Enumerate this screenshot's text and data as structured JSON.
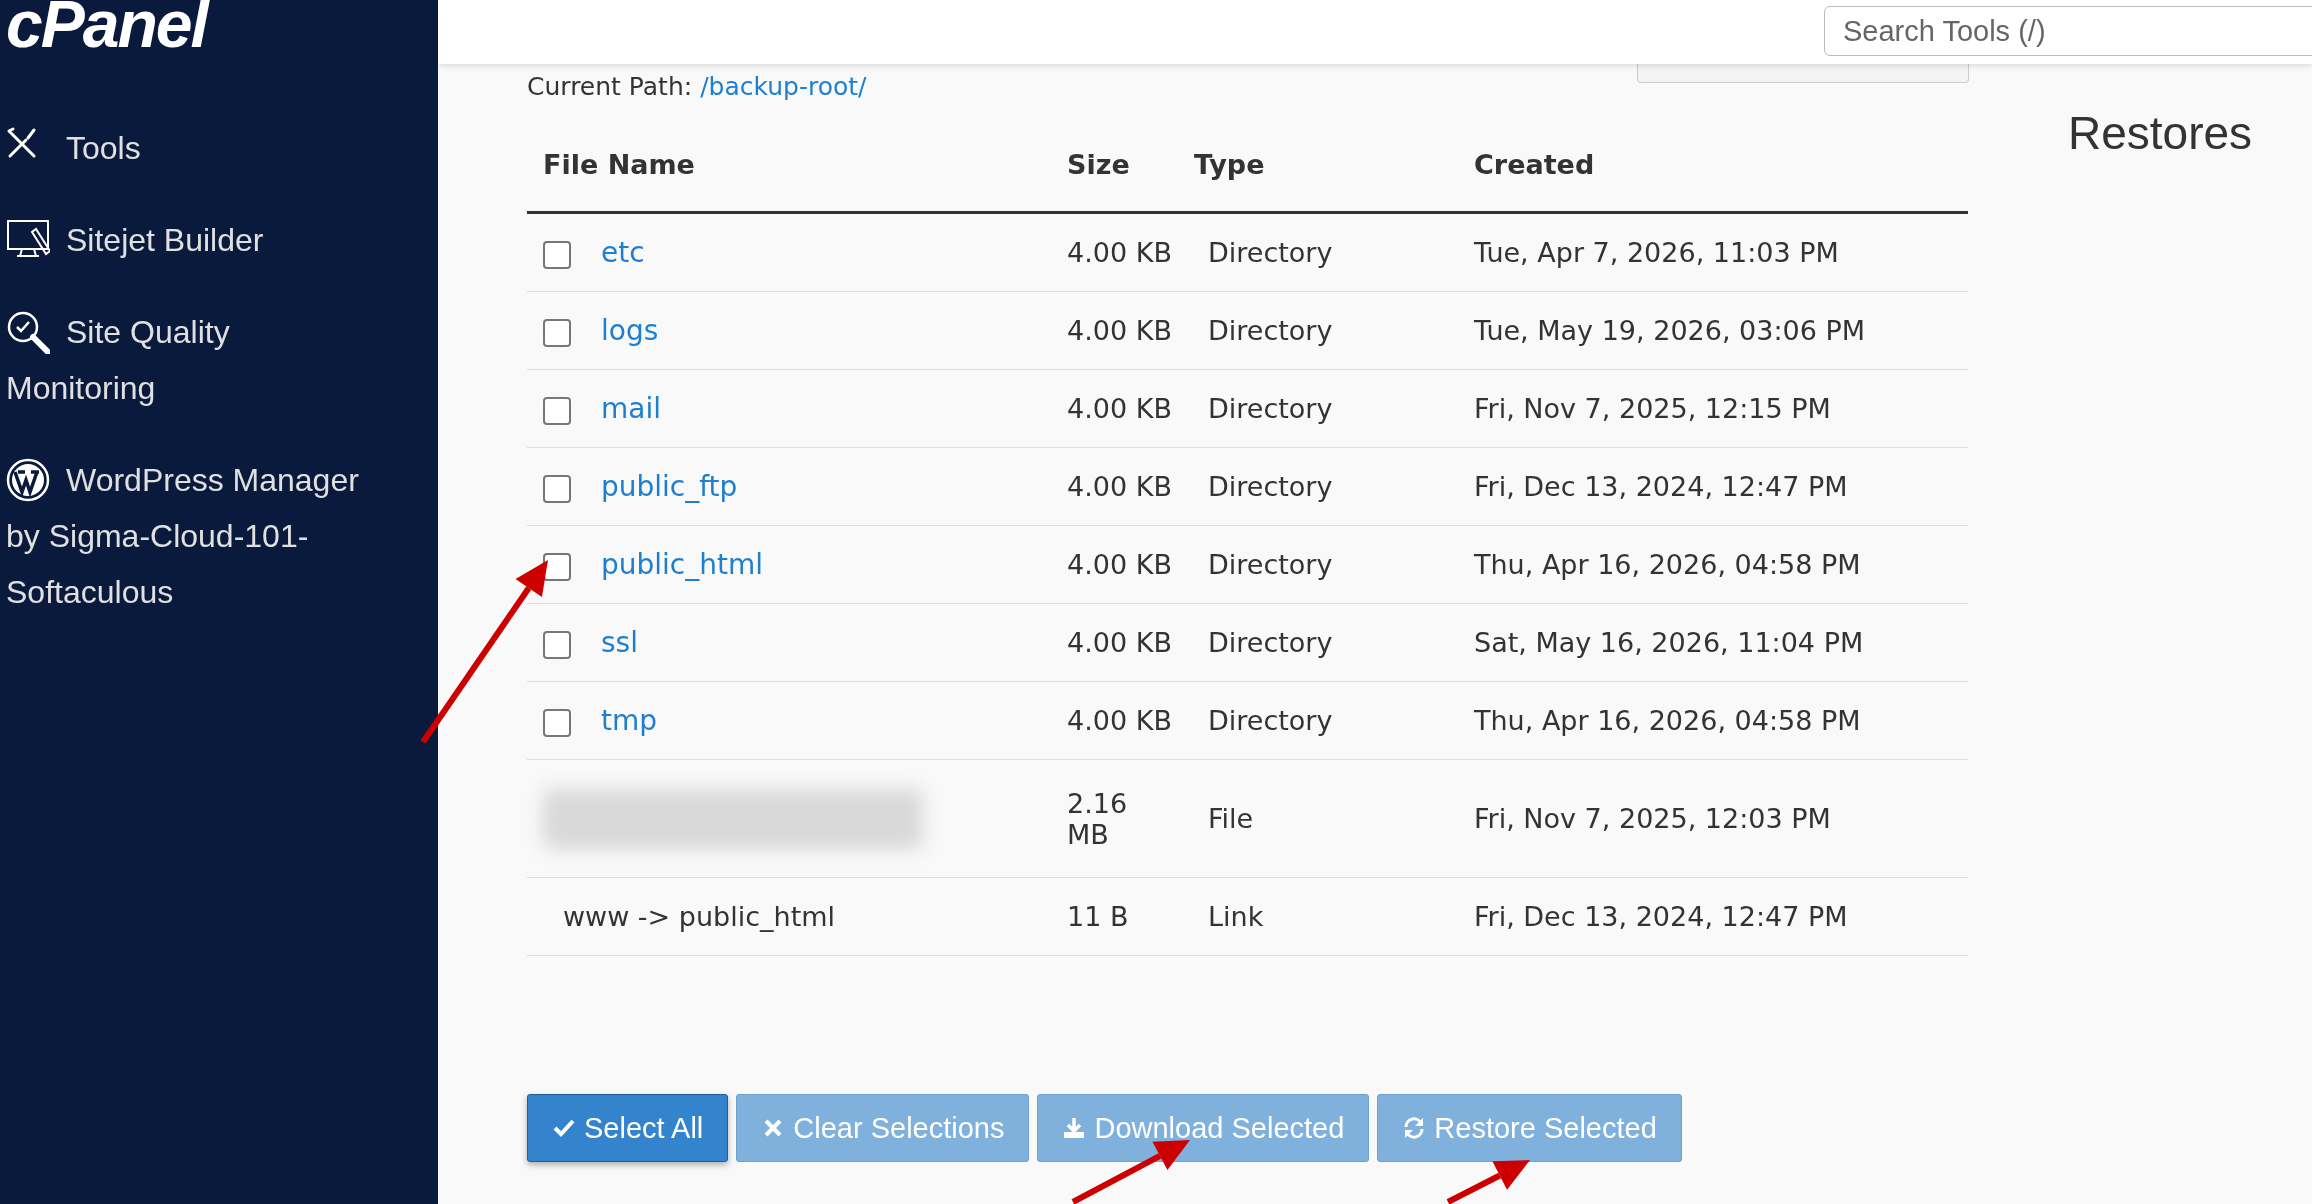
{
  "sidebar": {
    "logo": "cPanel",
    "items": [
      {
        "label": "Tools"
      },
      {
        "label": "Sitejet Builder"
      },
      {
        "label": "Site Quality Monitoring"
      },
      {
        "label": "WordPress Manager by Sigma-Cloud-101-Softaculous"
      }
    ]
  },
  "header": {
    "search": {
      "placeholder": "Search Tools (/)"
    }
  },
  "page_title": "Restores",
  "current_path": {
    "label": "Current Path:",
    "path": "/backup-root/"
  },
  "table": {
    "columns": [
      "File Name",
      "Size",
      "Type",
      "Created"
    ],
    "rows": [
      {
        "kind": "directory",
        "name": "etc",
        "checked": false,
        "size": "4.00 KB",
        "type": "Directory",
        "created": "Tue, Apr 7, 2026, 11:03 PM"
      },
      {
        "kind": "directory",
        "name": "logs",
        "checked": false,
        "size": "4.00 KB",
        "type": "Directory",
        "created": "Tue, May 19, 2026, 03:06 PM"
      },
      {
        "kind": "directory",
        "name": "mail",
        "checked": false,
        "size": "4.00 KB",
        "type": "Directory",
        "created": "Fri, Nov 7, 2025, 12:15 PM"
      },
      {
        "kind": "directory",
        "name": "public_ftp",
        "checked": false,
        "size": "4.00 KB",
        "type": "Directory",
        "created": "Fri, Dec 13, 2024, 12:47 PM"
      },
      {
        "kind": "directory",
        "name": "public_html",
        "checked": false,
        "size": "4.00 KB",
        "type": "Directory",
        "created": "Thu, Apr 16, 2026, 04:58 PM"
      },
      {
        "kind": "directory",
        "name": "ssl",
        "checked": false,
        "size": "4.00 KB",
        "type": "Directory",
        "created": "Sat, May 16, 2026, 11:04 PM"
      },
      {
        "kind": "directory",
        "name": "tmp",
        "checked": false,
        "size": "4.00 KB",
        "type": "Directory",
        "created": "Thu, Apr 16, 2026, 04:58 PM"
      },
      {
        "kind": "blurred",
        "size": "2.16 MB",
        "type": "File",
        "created": "Fri, Nov 7, 2025, 12:03 PM"
      },
      {
        "kind": "link",
        "name": "www -> public_html",
        "size": "11 B",
        "type": "Link",
        "created": "Fri, Dec 13, 2024, 12:47 PM"
      }
    ]
  },
  "buttons": [
    {
      "label": "Select All",
      "disabled": false
    },
    {
      "label": "Clear Selections",
      "disabled": true
    },
    {
      "label": "Download Selected",
      "disabled": true
    },
    {
      "label": "Restore Selected",
      "disabled": true
    }
  ]
}
